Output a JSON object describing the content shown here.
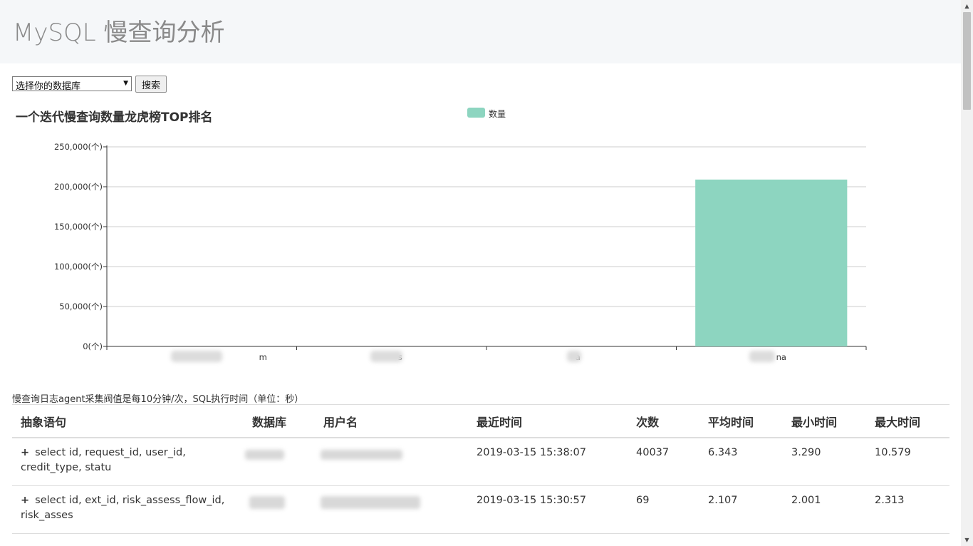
{
  "header": {
    "title": "MySQL 慢查询分析"
  },
  "toolbar": {
    "select_value": "选择你的数据库",
    "search_label": "搜索"
  },
  "chart_data": {
    "type": "bar",
    "title": "一个迭代慢查询数量龙虎榜TOP排名",
    "legend": "数量",
    "legend_position": "top-center",
    "categories": [
      "m",
      "s",
      "a",
      "na"
    ],
    "series": [
      {
        "name": "数量",
        "values": [
          0,
          0,
          0,
          209000
        ]
      }
    ],
    "ylim": [
      0,
      250000
    ],
    "yticks": [
      "0(个)",
      "50,000(个)",
      "100,000(个)",
      "150,000(个)",
      "200,000(个)",
      "250,000(个)"
    ],
    "grid": true,
    "color": "#8dd5c0"
  },
  "note": "慢查询日志agent采集阀值是每10分钟/次，SQL执行时间（单位：秒）",
  "table": {
    "headers": [
      "抽象语句",
      "数据库",
      "用户名",
      "最近时间",
      "次数",
      "平均时间",
      "最小时间",
      "最大时间"
    ],
    "rows": [
      {
        "statement": "select id, request_id, user_id, credit_type, statu",
        "database": "",
        "username": "",
        "last_time": "2019-03-15 15:38:07",
        "count": "40037",
        "avg_time": "6.343",
        "min_time": "3.290",
        "max_time": "10.579"
      },
      {
        "statement": "select id, ext_id, risk_assess_flow_id, risk_asses",
        "database": "",
        "username": "",
        "last_time": "2019-03-15 15:30:57",
        "count": "69",
        "avg_time": "2.107",
        "min_time": "2.001",
        "max_time": "2.313"
      }
    ]
  },
  "icons": {
    "expand": "+",
    "select_arrow": "▼",
    "scroll_up": "▲",
    "scroll_down": "▼"
  }
}
